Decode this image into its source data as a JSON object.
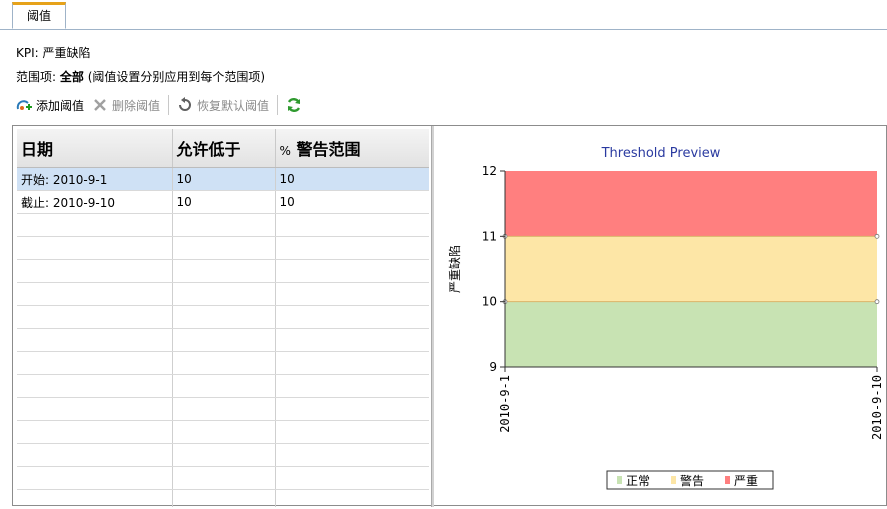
{
  "tab": {
    "label": "阈值"
  },
  "kpi_line": "KPI: 严重缺陷",
  "scope": {
    "prefix": "范围项:",
    "value": "全部",
    "note": "(阈值设置分别应用到每个范围项)"
  },
  "toolbar": {
    "add_label": "添加阈值",
    "delete_label": "删除阈值",
    "restore_label": "恢复默认阈值"
  },
  "grid": {
    "columns": [
      "日期",
      "允许低于",
      "警告范围"
    ],
    "pct_prefix": "%",
    "rows": [
      [
        "开始: 2010-9-1",
        "10",
        "10"
      ],
      [
        "截止: 2010-9-10",
        "10",
        "10"
      ]
    ]
  },
  "chart_data": {
    "type": "area",
    "title": "Threshold Preview",
    "ylabel": "严重缺陷",
    "xlabel": "",
    "x": [
      "2010-9-1",
      "2010-9-10"
    ],
    "ylim": [
      9,
      12
    ],
    "yticks": [
      "9",
      "10",
      "11",
      "12"
    ],
    "series": [
      {
        "name": "正常",
        "lower": [
          9,
          9
        ],
        "upper": [
          10,
          10
        ],
        "color": "#c8e3b3"
      },
      {
        "name": "警告",
        "lower": [
          10,
          10
        ],
        "upper": [
          11,
          11
        ],
        "color": "#fde6a6"
      },
      {
        "name": "严重",
        "lower": [
          11,
          11
        ],
        "upper": [
          12,
          12
        ],
        "color": "#ff7f7f"
      }
    ],
    "legend_position": "bottom-right",
    "grid": false
  }
}
